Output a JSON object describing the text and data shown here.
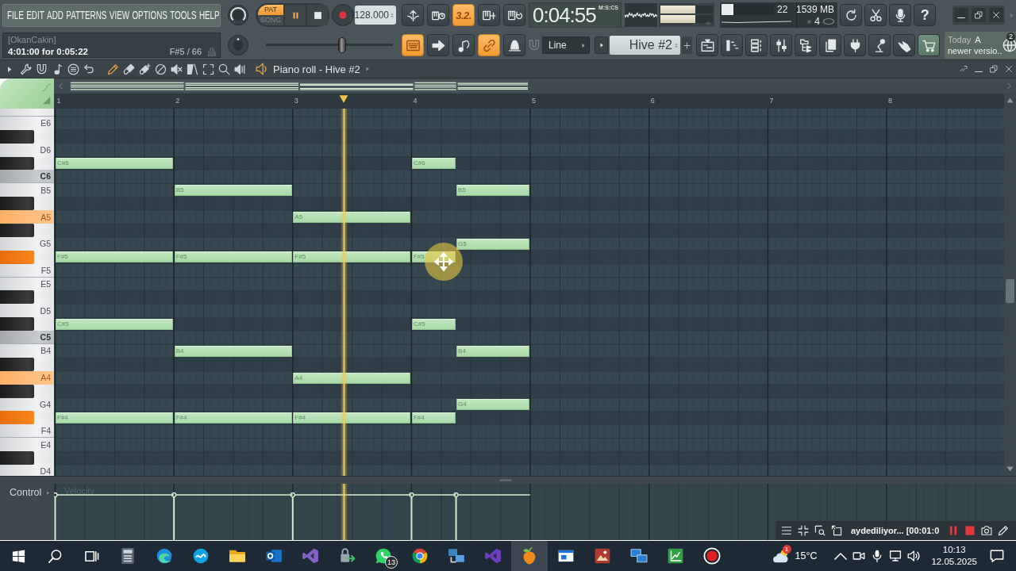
{
  "menu": [
    {
      "label": "FILE"
    },
    {
      "label": "EDIT"
    },
    {
      "label": "ADD"
    },
    {
      "label": "PATTERNS"
    },
    {
      "label": "VIEW"
    },
    {
      "label": "OPTIONS"
    },
    {
      "label": "TOOLS"
    },
    {
      "label": "HELP"
    }
  ],
  "hint": {
    "owner": "[OkanCakin]",
    "text": "4:01:00 for 0:05:22",
    "note": "F#5 / 66"
  },
  "transport": {
    "modes": [
      {
        "label": "PAT",
        "selected": true
      },
      {
        "label": "SONG",
        "selected": false
      }
    ],
    "playing": true,
    "tempo": "128.000"
  },
  "master_slider": {
    "level": 0.6
  },
  "record_tools": [
    {
      "kind": "arrow-arcs",
      "on": false
    },
    {
      "kind": "keys-clock",
      "on": false
    },
    {
      "kind": "countdown",
      "label": "3.2.",
      "on": true
    },
    {
      "kind": "keys-plus",
      "on": false
    },
    {
      "kind": "keys-loop",
      "on": false
    }
  ],
  "time": {
    "value": "0:04:55",
    "format": "M:S:CS"
  },
  "meters": [
    {
      "level": 0.66
    },
    {
      "level": 0.66
    }
  ],
  "performance": {
    "cpu": {
      "level": 0.22,
      "value": "22"
    },
    "memory": "1539 MB",
    "polyphony": "4"
  },
  "app_tools": [
    {
      "kind": "refresh"
    },
    {
      "kind": "scissors"
    },
    {
      "kind": "microphone"
    },
    {
      "kind": "help",
      "label": "?"
    }
  ],
  "edit_tools": [
    {
      "kind": "keyboard",
      "on": true
    },
    {
      "kind": "arrow",
      "on": false
    },
    {
      "kind": "note-curve",
      "on": false
    },
    {
      "kind": "link",
      "on": true
    },
    {
      "kind": "bell",
      "on": false
    }
  ],
  "snap": {
    "value": "Line"
  },
  "pattern": {
    "name": "Hive #2"
  },
  "windows": [
    {
      "kind": "playlist"
    },
    {
      "kind": "piano-roll"
    },
    {
      "kind": "channel-rack"
    },
    {
      "kind": "mixer"
    },
    {
      "kind": "browser"
    },
    {
      "kind": "files"
    },
    {
      "kind": "plugin"
    },
    {
      "kind": "lamp"
    },
    {
      "kind": "hand"
    },
    {
      "kind": "cart"
    }
  ],
  "news": {
    "date": "Today",
    "headline": "A",
    "text": "newer versio..",
    "badge": "2"
  },
  "piano_roll": {
    "title": "Piano roll - Hive #2",
    "menu_tools": [
      {
        "kind": "wrench"
      },
      {
        "kind": "magnet"
      },
      {
        "kind": "note"
      },
      {
        "kind": "menu-circle"
      },
      {
        "kind": "undo"
      }
    ],
    "tools": [
      {
        "kind": "pencil",
        "selected": true
      },
      {
        "kind": "brush",
        "selected": false
      },
      {
        "kind": "brush-plus",
        "selected": false
      },
      {
        "kind": "ban",
        "selected": false
      },
      {
        "kind": "mute",
        "selected": false
      },
      {
        "kind": "slice",
        "selected": false
      },
      {
        "kind": "select",
        "selected": false
      },
      {
        "kind": "zoom",
        "selected": false
      },
      {
        "kind": "playback",
        "selected": false
      }
    ],
    "bars": [
      "1",
      "2",
      "3",
      "4",
      "5",
      "6",
      "7",
      "8"
    ],
    "playhead": {
      "level": 0.305
    },
    "keys": [
      {
        "kind": "white",
        "highlighted": false
      },
      {
        "kind": "white",
        "label": "E6",
        "highlighted": false
      },
      {
        "kind": "black",
        "highlighted": false
      },
      {
        "kind": "white",
        "label": "D6",
        "highlighted": false
      },
      {
        "kind": "black",
        "highlighted": false,
        "track": [
          {
            "kind": "bar",
            "label": "C#6"
          },
          {
            "kind": "rest-bar"
          },
          {
            "kind": "rest-bar"
          },
          {
            "kind": "short",
            "label": "C#6"
          }
        ]
      },
      {
        "kind": "c",
        "label": "C6",
        "highlighted": false
      },
      {
        "kind": "white",
        "label": "B5",
        "highlighted": false,
        "track": [
          {
            "kind": "rest-bar"
          },
          {
            "kind": "bar",
            "label": "B5"
          },
          {
            "kind": "rest-bar"
          },
          {
            "kind": "rest-short"
          },
          {
            "kind": "long",
            "label": "B5"
          }
        ]
      },
      {
        "kind": "black",
        "highlighted": false
      },
      {
        "kind": "white",
        "label": "A5",
        "highlighted": true,
        "track": [
          {
            "kind": "rest-bar"
          },
          {
            "kind": "rest-bar"
          },
          {
            "kind": "bar",
            "label": "A5"
          }
        ]
      },
      {
        "kind": "black",
        "highlighted": false
      },
      {
        "kind": "white",
        "label": "G5",
        "highlighted": false,
        "track": [
          {
            "kind": "rest-bar"
          },
          {
            "kind": "rest-bar"
          },
          {
            "kind": "rest-bar"
          },
          {
            "kind": "rest-short"
          },
          {
            "kind": "long",
            "label": "G5"
          }
        ]
      },
      {
        "kind": "black",
        "highlighted": true,
        "track": [
          {
            "kind": "bar",
            "label": "F#5"
          },
          {
            "kind": "bar",
            "label": "F#5"
          },
          {
            "kind": "bar",
            "label": "F#5"
          },
          {
            "kind": "short",
            "label": "F#5"
          }
        ]
      },
      {
        "kind": "white",
        "label": "F5",
        "highlighted": false
      },
      {
        "kind": "white",
        "label": "E5",
        "highlighted": false
      },
      {
        "kind": "black",
        "highlighted": false
      },
      {
        "kind": "white",
        "label": "D5",
        "highlighted": false
      },
      {
        "kind": "black",
        "highlighted": false,
        "track": [
          {
            "kind": "bar",
            "label": "C#5"
          },
          {
            "kind": "rest-bar"
          },
          {
            "kind": "rest-bar"
          },
          {
            "kind": "short",
            "label": "C#5"
          }
        ]
      },
      {
        "kind": "c",
        "label": "C5",
        "highlighted": false
      },
      {
        "kind": "white",
        "label": "B4",
        "highlighted": false,
        "track": [
          {
            "kind": "rest-bar"
          },
          {
            "kind": "bar",
            "label": "B4"
          },
          {
            "kind": "rest-bar"
          },
          {
            "kind": "rest-short"
          },
          {
            "kind": "long",
            "label": "B4"
          }
        ]
      },
      {
        "kind": "black",
        "highlighted": false
      },
      {
        "kind": "white",
        "label": "A4",
        "highlighted": true,
        "track": [
          {
            "kind": "rest-bar"
          },
          {
            "kind": "rest-bar"
          },
          {
            "kind": "bar",
            "label": "A4"
          }
        ]
      },
      {
        "kind": "black",
        "highlighted": false
      },
      {
        "kind": "white",
        "label": "G4",
        "highlighted": false,
        "track": [
          {
            "kind": "rest-bar"
          },
          {
            "kind": "rest-bar"
          },
          {
            "kind": "rest-bar"
          },
          {
            "kind": "rest-short"
          },
          {
            "kind": "long",
            "label": "G4"
          }
        ]
      },
      {
        "kind": "black",
        "highlighted": true,
        "track": [
          {
            "kind": "bar",
            "label": "F#4"
          },
          {
            "kind": "bar",
            "label": "F#4"
          },
          {
            "kind": "bar",
            "label": "F#4"
          },
          {
            "kind": "short",
            "label": "F#4"
          }
        ]
      },
      {
        "kind": "white",
        "label": "F4",
        "highlighted": false
      },
      {
        "kind": "white",
        "label": "E4",
        "highlighted": false
      },
      {
        "kind": "black",
        "highlighted": false
      },
      {
        "kind": "white",
        "label": "D4",
        "highlighted": false
      }
    ],
    "control": {
      "label": "Control",
      "lane": "Velocity"
    }
  },
  "recorder": {
    "status": "aydediliyor... [00:01:0"
  },
  "taskbar": {
    "apps": [
      {
        "kind": "start",
        "selected": false
      },
      {
        "kind": "search",
        "selected": false
      },
      {
        "kind": "task-view",
        "selected": false
      },
      {
        "kind": "calculator",
        "selected": false
      },
      {
        "kind": "edge",
        "selected": false
      },
      {
        "kind": "skype",
        "selected": false
      },
      {
        "kind": "explorer",
        "selected": false
      },
      {
        "kind": "outlook",
        "selected": false
      },
      {
        "kind": "vs",
        "selected": false
      },
      {
        "kind": "vpn",
        "selected": false
      },
      {
        "kind": "whatsapp",
        "selected": false,
        "badge": "13"
      },
      {
        "kind": "chrome",
        "selected": false
      },
      {
        "kind": "network",
        "selected": false
      },
      {
        "kind": "vs-alt",
        "selected": false
      },
      {
        "kind": "fl",
        "selected": true
      },
      {
        "kind": "window-app",
        "selected": false
      },
      {
        "kind": "image-app",
        "selected": false
      },
      {
        "kind": "remote",
        "selected": false
      },
      {
        "kind": "chart-app",
        "selected": false
      },
      {
        "kind": "recorder",
        "selected": false
      }
    ],
    "weather": {
      "temp": "15°C",
      "badge": "1"
    },
    "time": "10:13",
    "date": "12.05.2025"
  }
}
